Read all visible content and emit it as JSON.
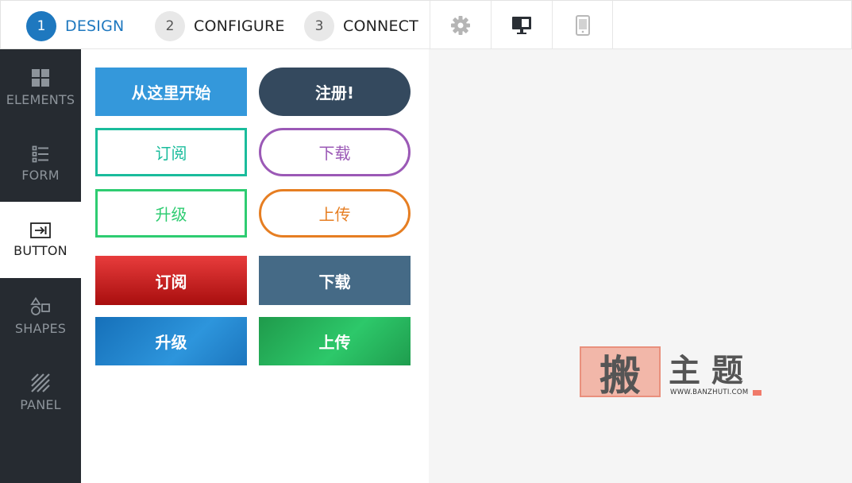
{
  "steps": [
    {
      "num": "1",
      "label": "DESIGN",
      "active": true
    },
    {
      "num": "2",
      "label": "CONFIGURE",
      "active": false
    },
    {
      "num": "3",
      "label": "CONNECT",
      "active": false
    }
  ],
  "toolbar": {
    "settings_icon": "gear-icon",
    "desktop_icon": "desktop-monitor-icon",
    "mobile_icon": "mobile-phone-icon"
  },
  "sidebar": {
    "items": [
      {
        "label": "ELEMENTS",
        "icon": "grid-icon",
        "active": false
      },
      {
        "label": "FORM",
        "icon": "form-list-icon",
        "active": false
      },
      {
        "label": "BUTTON",
        "icon": "button-arrow-icon",
        "active": true
      },
      {
        "label": "SHAPES",
        "icon": "shapes-icon",
        "active": false
      },
      {
        "label": "PANEL",
        "icon": "hatched-panel-icon",
        "active": false
      }
    ]
  },
  "buttons": {
    "start": "从这里开始",
    "register": "注册!",
    "subscribe_outline": "订阅",
    "download_outline": "下载",
    "upgrade_outline": "升级",
    "upload_outline": "上传",
    "subscribe_red": "订阅",
    "download_slate": "下载",
    "upgrade_blue": "升级",
    "upload_green": "上传"
  },
  "watermark": {
    "seal_char": "搬",
    "title": "主题",
    "url": "WWW.BANZHUTI.COM"
  },
  "colors": {
    "accent_blue": "#1e78bf",
    "sidebar_bg": "#262b31",
    "canvas_bg": "#f5f5f5"
  }
}
